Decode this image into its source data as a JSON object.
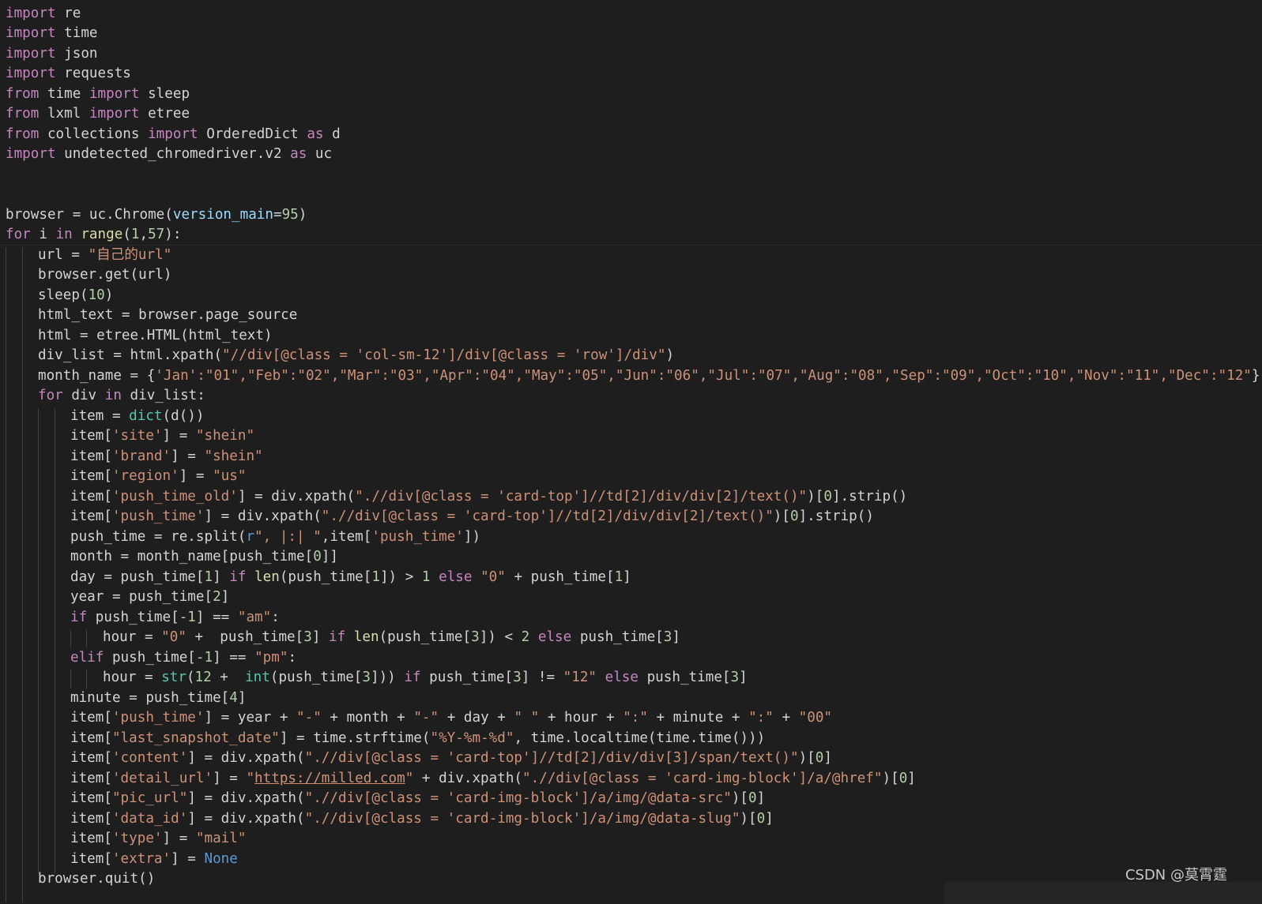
{
  "watermark": "CSDN @莫霄霆",
  "code": {
    "l1_import": "import",
    "l1_mod": " re",
    "l2_import": "import",
    "l2_mod": " time",
    "l3_import": "import",
    "l3_mod": " json",
    "l4_import": "import",
    "l4_mod": " requests",
    "l5_from": "from",
    "l5_mod": " time ",
    "l5_import": "import",
    "l5_name": " sleep",
    "l6_from": "from",
    "l6_mod": " lxml ",
    "l6_import": "import",
    "l6_name": " etree",
    "l7_from": "from",
    "l7_mod": " collections ",
    "l7_import": "import",
    "l7_name": " OrderedDict ",
    "l7_as": "as",
    "l7_alias": " d",
    "l8_import": "import",
    "l8_mod": " undetected_chromedriver.v2 ",
    "l8_as": "as",
    "l8_alias": " uc",
    "l11_a": "browser = uc.Chrome(",
    "l11_param": "version_main",
    "l11_eq": "=",
    "l11_num": "95",
    "l11_end": ")",
    "l12_for": "for",
    "l12_i": " i ",
    "l12_in": "in",
    "l12_sp": " ",
    "l12_range": "range",
    "l12_p1": "(",
    "l12_n1": "1",
    "l12_comma": ",",
    "l12_n2": "57",
    "l12_end": "):",
    "l13_a": "url = ",
    "l13_str": "\"自己的url\"",
    "l14_a": "browser.get(url)",
    "l15_a": "sleep(",
    "l15_num": "10",
    "l15_end": ")",
    "l16_a": "html_text = browser.page_source",
    "l17_a": "html = etree.HTML(html_text)",
    "l18_a": "div_list = html.xpath(",
    "l18_str": "\"//div[@class = 'col-sm-12']/div[@class = 'row']/div\"",
    "l18_end": ")",
    "l19_a": "month_name = {",
    "l19_str": "'Jan'",
    "l19_rest": ":\"01\",\"Feb\":\"02\",\"Mar\":\"03\",\"Apr\":\"04\",\"May\":\"05\",\"Jun\":\"06\",\"Jul\":\"07\",\"Aug\":\"08\",\"Sep\":\"09\",\"Oct\":\"10\",\"Nov\":\"11\",\"Dec\":\"12\"",
    "l19_end": "}",
    "l20_for": "for",
    "l20_a": " div ",
    "l20_in": "in",
    "l20_b": " div_list:",
    "l21_a": "item = ",
    "l21_dict": "dict",
    "l21_b": "(d())",
    "l22_a": "item[",
    "l22_key": "'site'",
    "l22_b": "] = ",
    "l22_val": "\"shein\"",
    "l23_a": "item[",
    "l23_key": "'brand'",
    "l23_b": "] = ",
    "l23_val": "\"shein\"",
    "l24_a": "item[",
    "l24_key": "'region'",
    "l24_b": "] = ",
    "l24_val": "\"us\"",
    "l25_a": "item[",
    "l25_key": "'push_time_old'",
    "l25_b": "] = div.xpath(",
    "l25_str": "\".//div[@class = 'card-top']//td[2]/div/div[2]/text()\"",
    "l25_c": ")[",
    "l25_num": "0",
    "l25_d": "].strip()",
    "l26_a": "item[",
    "l26_key": "'push_time'",
    "l26_b": "] = div.xpath(",
    "l26_str": "\".//div[@class = 'card-top']//td[2]/div/div[2]/text()\"",
    "l26_c": ")[",
    "l26_num": "0",
    "l26_d": "].strip()",
    "l27_a": "push_time = re.split(",
    "l27_r": "r",
    "l27_str": "\", |:| \"",
    "l27_b": ",item[",
    "l27_key": "'push_time'",
    "l27_end": "])",
    "l28_a": "month = month_name[push_time[",
    "l28_num": "0",
    "l28_end": "]]",
    "l29_a": "day = push_time[",
    "l29_n1": "1",
    "l29_b": "] ",
    "l29_if": "if",
    "l29_sp": " ",
    "l29_len": "len",
    "l29_c": "(push_time[",
    "l29_n2": "1",
    "l29_d": "]) > ",
    "l29_n3": "1",
    "l29_sp2": " ",
    "l29_else": "else",
    "l29_sp3": " ",
    "l29_str": "\"0\"",
    "l29_e": " + push_time[",
    "l29_n4": "1",
    "l29_end": "]",
    "l30_a": "year = push_time[",
    "l30_num": "2",
    "l30_end": "]",
    "l31_if": "if",
    "l31_a": " push_time[",
    "l31_num": "-1",
    "l31_b": "] == ",
    "l31_str": "\"am\"",
    "l31_end": ":",
    "l32_a": "hour = ",
    "l32_str": "\"0\"",
    "l32_b": " +  push_time[",
    "l32_n1": "3",
    "l32_c": "] ",
    "l32_if": "if",
    "l32_sp": " ",
    "l32_len": "len",
    "l32_d": "(push_time[",
    "l32_n2": "3",
    "l32_e": "]) < ",
    "l32_n3": "2",
    "l32_sp2": " ",
    "l32_else": "else",
    "l32_f": " push_time[",
    "l32_n4": "3",
    "l32_end": "]",
    "l33_elif": "elif",
    "l33_a": " push_time[",
    "l33_num": "-1",
    "l33_b": "] == ",
    "l33_str": "\"pm\"",
    "l33_end": ":",
    "l34_a": "hour = ",
    "l34_strf": "str",
    "l34_b": "(",
    "l34_n1": "12",
    "l34_c": " +  ",
    "l34_int": "int",
    "l34_d": "(push_time[",
    "l34_n2": "3",
    "l34_e": "])) ",
    "l34_if": "if",
    "l34_f": " push_time[",
    "l34_n3": "3",
    "l34_g": "] != ",
    "l34_str": "\"12\"",
    "l34_sp": " ",
    "l34_else": "else",
    "l34_h": " push_time[",
    "l34_n4": "3",
    "l34_end": "]",
    "l35_a": "minute = push_time[",
    "l35_num": "4",
    "l35_end": "]",
    "l36_a": "item[",
    "l36_key": "'push_time'",
    "l36_b": "] = year + ",
    "l36_s1": "\"-\"",
    "l36_c": " + month + ",
    "l36_s2": "\"-\"",
    "l36_d": " + day + ",
    "l36_s3": "\" \"",
    "l36_e": " + hour + ",
    "l36_s4": "\":\"",
    "l36_f": " + minute + ",
    "l36_s5": "\":\"",
    "l36_g": " + ",
    "l36_s6": "\"00\"",
    "l37_a": "item[",
    "l37_key": "\"last_snapshot_date\"",
    "l37_b": "] = time.strftime(",
    "l37_str": "\"%Y-%m-%d\"",
    "l37_end": ", time.localtime(time.time()))",
    "l38_a": "item[",
    "l38_key": "'content'",
    "l38_b": "] = div.xpath(",
    "l38_str": "\".//div[@class = 'card-top']//td[2]/div/div[3]/span/text()\"",
    "l38_c": ")[",
    "l38_num": "0",
    "l38_end": "]",
    "l39_a": "item[",
    "l39_key": "'detail_url'",
    "l39_b": "] = ",
    "l39_q1": "\"",
    "l39_link": "https://milled.com",
    "l39_q2": "\"",
    "l39_c": " + div.xpath(",
    "l39_str": "\".//div[@class = 'card-img-block']/a/@href\"",
    "l39_d": ")[",
    "l39_num": "0",
    "l39_end": "]",
    "l40_a": "item[",
    "l40_key": "\"pic_url\"",
    "l40_b": "] = div.xpath(",
    "l40_str": "\".//div[@class = 'card-img-block']/a/img/@data-src\"",
    "l40_c": ")[",
    "l40_num": "0",
    "l40_end": "]",
    "l41_a": "item[",
    "l41_key": "'data_id'",
    "l41_b": "] = div.xpath(",
    "l41_str": "\".//div[@class = 'card-img-block']/a/img/@data-slug\"",
    "l41_c": ")[",
    "l41_num": "0",
    "l41_end": "]",
    "l42_a": "item[",
    "l42_key": "'type'",
    "l42_b": "] = ",
    "l42_val": "\"mail\"",
    "l43_a": "item[",
    "l43_key": "'extra'",
    "l43_b": "] = ",
    "l43_none": "None",
    "l44_a": "browser.quit()"
  }
}
